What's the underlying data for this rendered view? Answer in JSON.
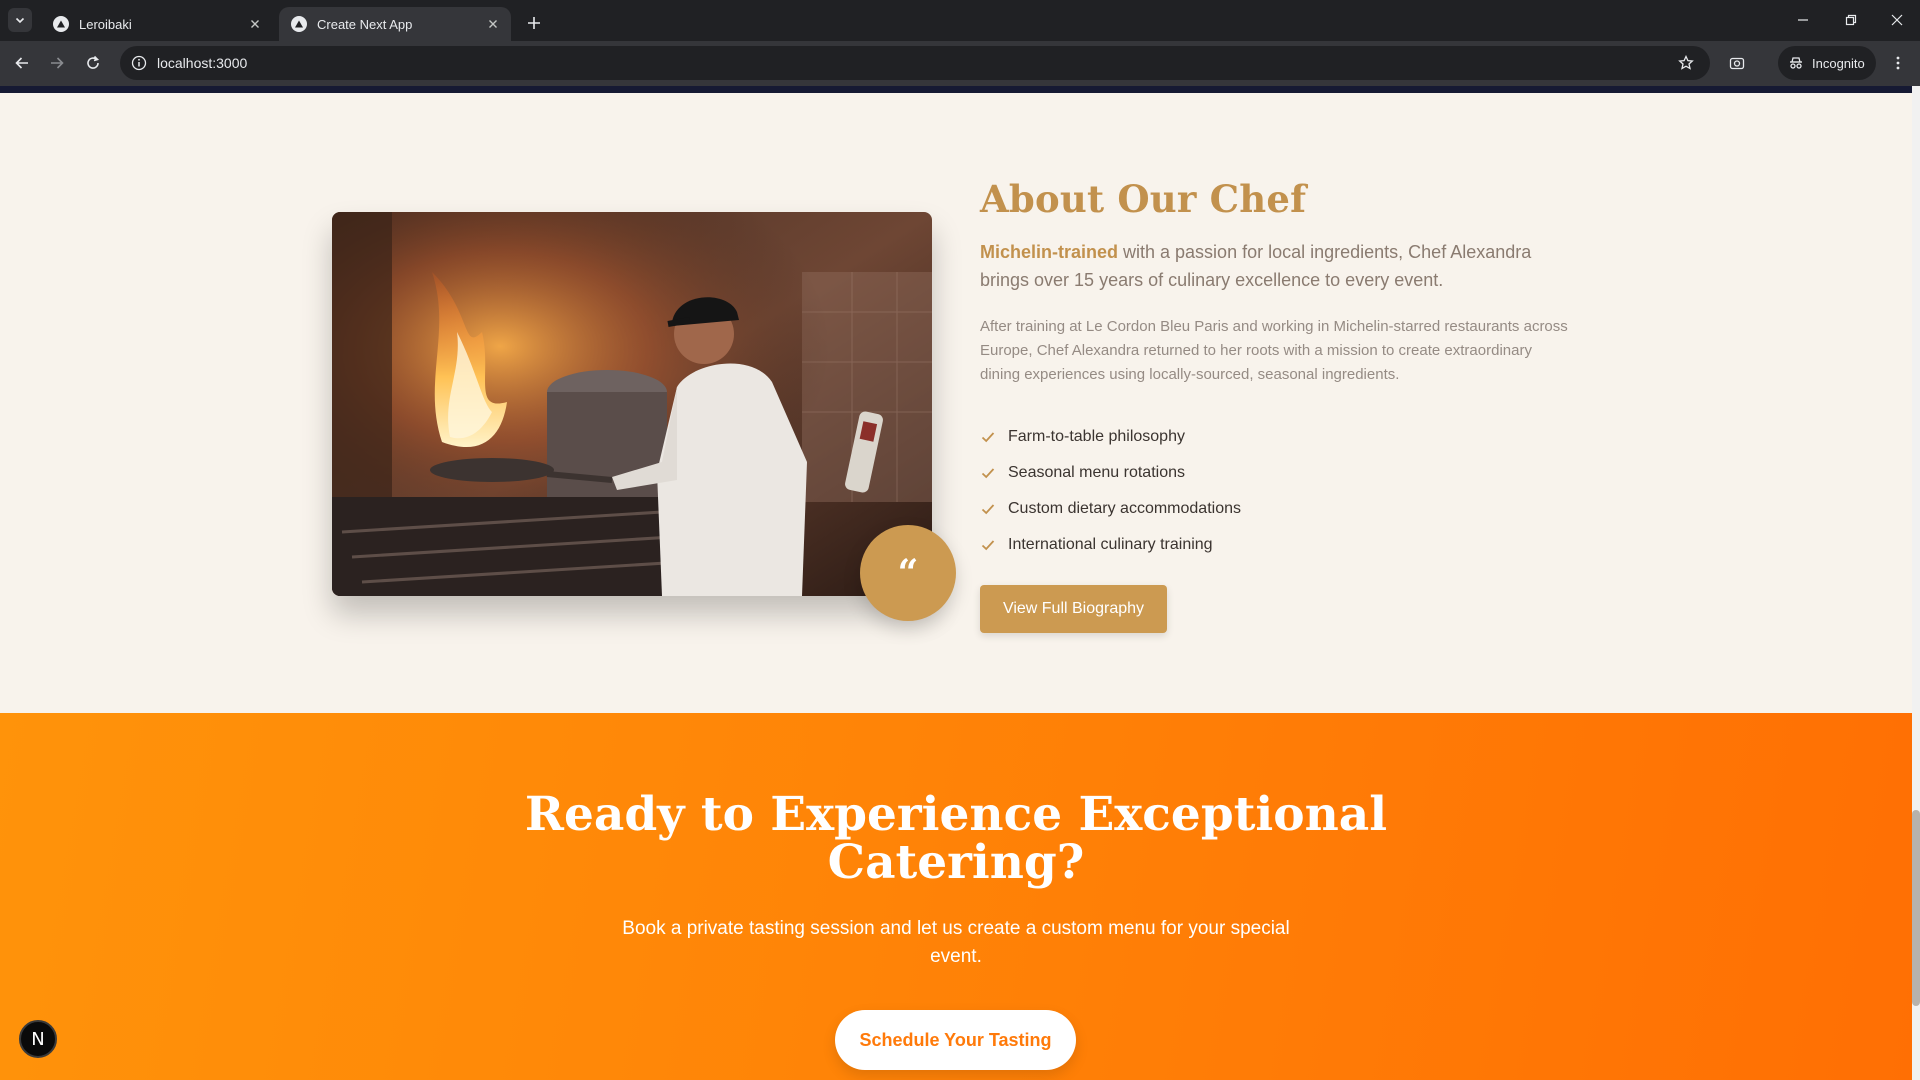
{
  "browser": {
    "tabs": [
      {
        "title": "Leroibaki",
        "active": false
      },
      {
        "title": "Create Next App",
        "active": true
      }
    ],
    "url": "localhost:3000",
    "incognito_label": "Incognito"
  },
  "about": {
    "heading": "About Our Chef",
    "lead_highlight": "Michelin-trained",
    "lead_rest": " with a passion for local ingredients, Chef Alexandra brings over 15 years of culinary excellence to every event.",
    "body": "After training at Le Cordon Bleu Paris and working in Michelin-starred restaurants across Europe, Chef Alexandra returned to her roots with a mission to create extraordinary dining experiences using locally-sourced, seasonal ingredients.",
    "features": [
      "Farm-to-table philosophy",
      "Seasonal menu rotations",
      "Custom dietary accommodations",
      "International culinary training"
    ],
    "button_label": "View Full Biography",
    "quote_glyph": "“"
  },
  "cta": {
    "title_line1": "Ready to Experience Exceptional",
    "title_line2": "Catering?",
    "subtitle": "Book a private tasting session and let us create a custom menu for your special event.",
    "button_label": "Schedule Your Tasting"
  },
  "dev_badge": "N",
  "colors": {
    "accent_gold": "#cc9a51",
    "cta_orange": "#ff8407",
    "page_bg": "#f8f3ec"
  }
}
